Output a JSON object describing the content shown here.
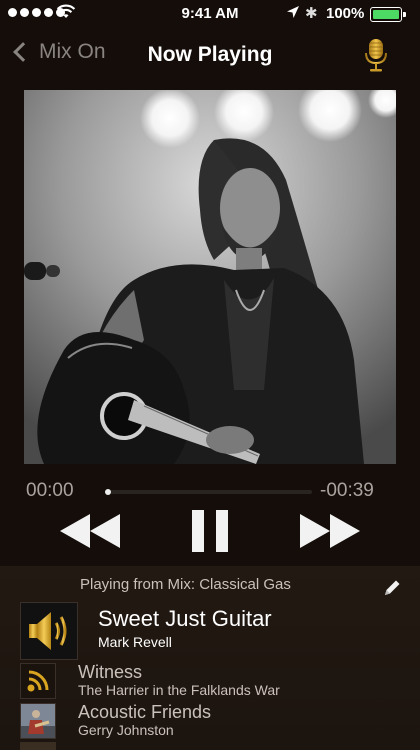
{
  "status_bar": {
    "time": "9:41 AM",
    "battery_percent": "100%",
    "battery_level": 1.0,
    "signal_bars": 5
  },
  "nav": {
    "back_label": "Mix On",
    "title": "Now Playing",
    "mic_icon": "microphone-icon"
  },
  "now_playing": {
    "artwork": "guitarist-photo",
    "elapsed": "00:00",
    "remaining": "-00:39",
    "progress": 0.0
  },
  "controls": {
    "rewind_icon": "rewind-icon",
    "pause_icon": "pause-icon",
    "forward_icon": "fast-forward-icon"
  },
  "queue": {
    "playing_from": "Playing from Mix: Classical Gas",
    "edit_icon": "pencil-icon",
    "tracks": [
      {
        "title": "Sweet Just Guitar",
        "artist": "Mark Revell",
        "icon": "speaker-icon",
        "current": true
      },
      {
        "title": "Witness",
        "artist": "The Harrier in the Falklands War",
        "icon": "podcast-icon"
      },
      {
        "title": "Acoustic Friends",
        "artist": "Gerry Johnston",
        "icon": "album-art"
      },
      {
        "title": "",
        "artist": "",
        "icon": "album-art"
      }
    ]
  },
  "colors": {
    "background": "#140d0a",
    "accent_gold": "#d9a520",
    "battery_green": "#4cd964",
    "muted_text": "#aaa39d"
  }
}
